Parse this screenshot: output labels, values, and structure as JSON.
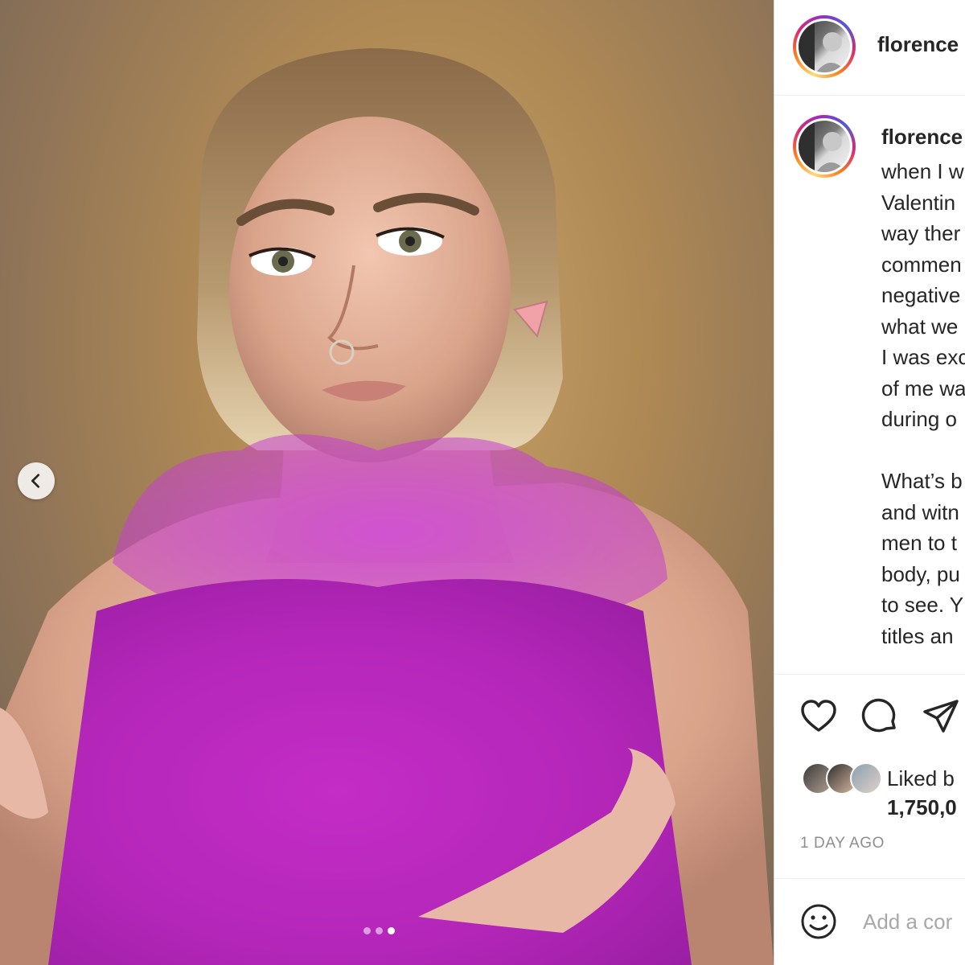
{
  "post": {
    "username": "florence",
    "media": {
      "description": "portrait photo",
      "current_slide": 3,
      "total_slides": 3
    },
    "caption": {
      "username": "florence",
      "lines": [
        "when I w",
        "Valentin",
        "way ther",
        "commen",
        "negative",
        "what we",
        "I was exc",
        "of me wa",
        "during o",
        "",
        "What’s b",
        "and witn",
        "men to t",
        "body, pu",
        "to see. Y",
        "titles an"
      ]
    },
    "likes": {
      "prefix": "Liked b",
      "count": "1,750,0"
    },
    "timestamp": "1 DAY AGO",
    "comment_box": {
      "placeholder": "Add a cor"
    }
  },
  "icons": {
    "like": "heart-icon",
    "comment": "comment-icon",
    "share": "paper-plane-icon",
    "emoji": "emoji-icon",
    "prev": "chevron-left-icon"
  },
  "colors": {
    "text": "#262626",
    "secondary": "#8e8e8e",
    "divider": "#dbdbdb",
    "dress": "#c62fc8"
  }
}
